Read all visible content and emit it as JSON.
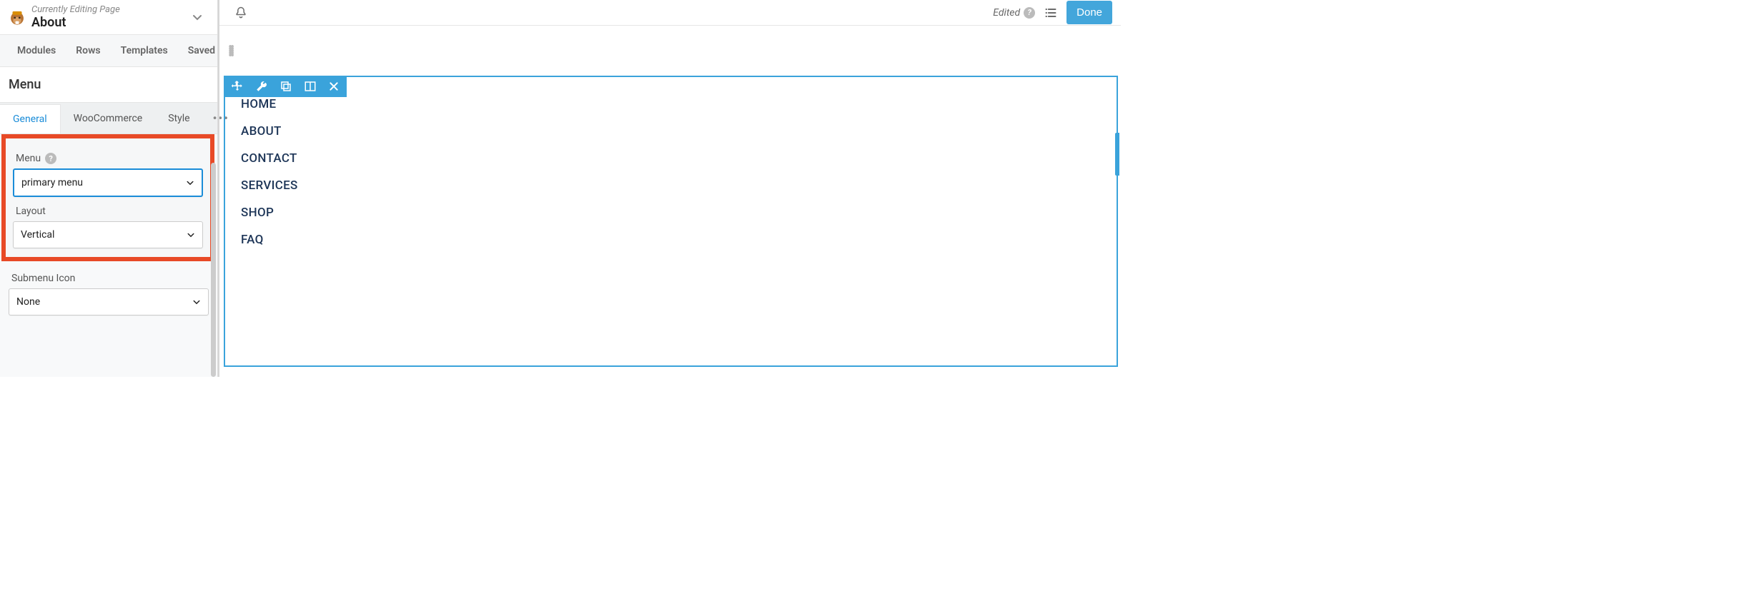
{
  "header": {
    "editing_label": "Currently Editing Page",
    "page_title": "About"
  },
  "topbar": {
    "edited_label": "Edited",
    "done_label": "Done"
  },
  "tabs": {
    "modules": "Modules",
    "rows": "Rows",
    "templates": "Templates",
    "saved": "Saved"
  },
  "panel": {
    "title": "Menu",
    "subtabs": {
      "general": "General",
      "woocommerce": "WooCommerce",
      "style": "Style"
    },
    "fields": {
      "menu_label": "Menu",
      "menu_value": "primary menu",
      "layout_label": "Layout",
      "layout_value": "Vertical",
      "submenu_icon_label": "Submenu Icon",
      "submenu_icon_value": "None"
    }
  },
  "canvas": {
    "menu_items": [
      "HOME",
      "ABOUT",
      "CONTACT",
      "SERVICES",
      "SHOP",
      "FAQ"
    ]
  },
  "icons": {
    "help": "?",
    "more": "•••"
  }
}
